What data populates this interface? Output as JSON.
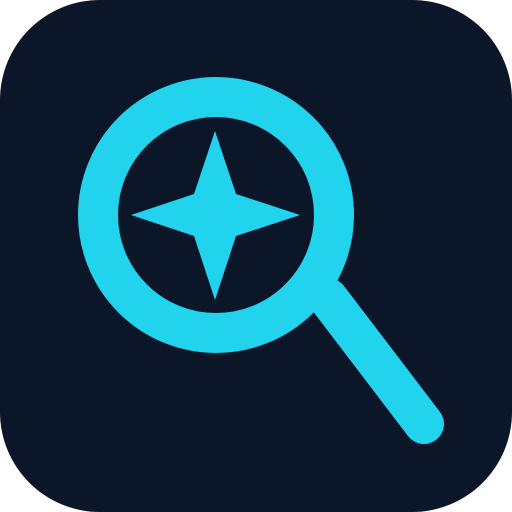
{
  "icon": {
    "name": "search-sparkle-icon",
    "glyphs": [
      "magnifying-glass-icon",
      "four-point-star-icon"
    ]
  },
  "colors": {
    "background": "#0b1629",
    "accent": "#22d3ee",
    "page": "#ffffff"
  }
}
